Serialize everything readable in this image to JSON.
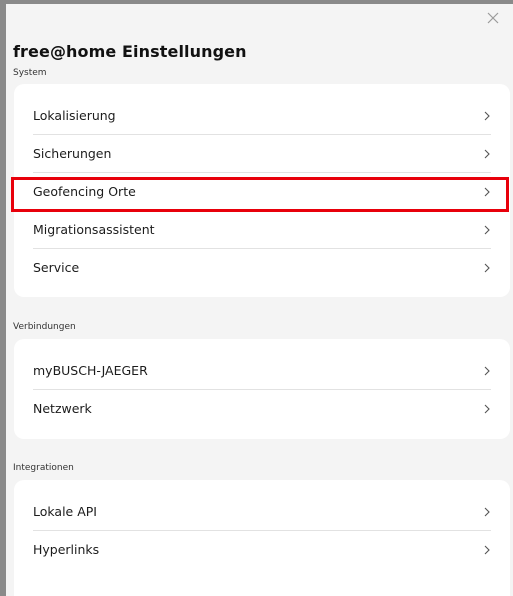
{
  "header": {
    "title": "free@home Einstellungen",
    "close_icon": "close-icon"
  },
  "sections": {
    "system": {
      "label": "System",
      "items": [
        {
          "label": "Lokalisierung"
        },
        {
          "label": "Sicherungen"
        },
        {
          "label": "Geofencing Orte"
        },
        {
          "label": "Migrationsassistent"
        },
        {
          "label": "Service"
        }
      ]
    },
    "verbindungen": {
      "label": "Verbindungen",
      "items": [
        {
          "label": "myBUSCH-JAEGER"
        },
        {
          "label": "Netzwerk"
        }
      ]
    },
    "integrationen": {
      "label": "Integrationen",
      "items": [
        {
          "label": "Lokale API"
        },
        {
          "label": "Hyperlinks"
        }
      ]
    }
  },
  "colors": {
    "highlight": "#e8000b",
    "background": "#f4f4f4",
    "card": "#ffffff"
  },
  "icons": {
    "row_arrow": "chevron-right-icon"
  }
}
